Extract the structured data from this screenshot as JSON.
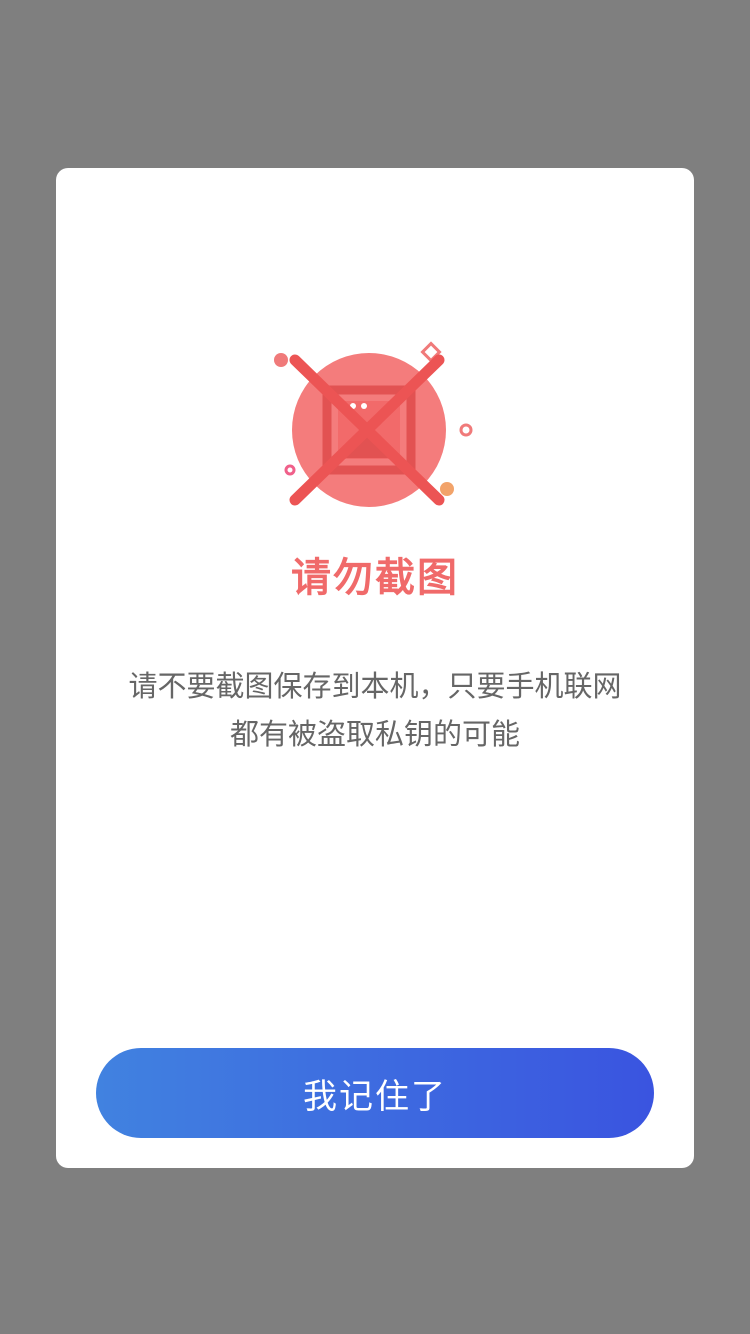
{
  "dialog": {
    "illustration_icon": "no-screenshot-icon",
    "title": "请勿截图",
    "message_line1": "请不要截图保存到本机，只要手机联网",
    "message_line2": "都有被盗取私钥的可能",
    "confirm_label": "我记住了"
  },
  "colors": {
    "overlay": "#7f7f7f",
    "title": "#f06a6a",
    "message": "#666666",
    "button_gradient_start": "#4182e0",
    "button_gradient_end": "#3a54e0"
  }
}
